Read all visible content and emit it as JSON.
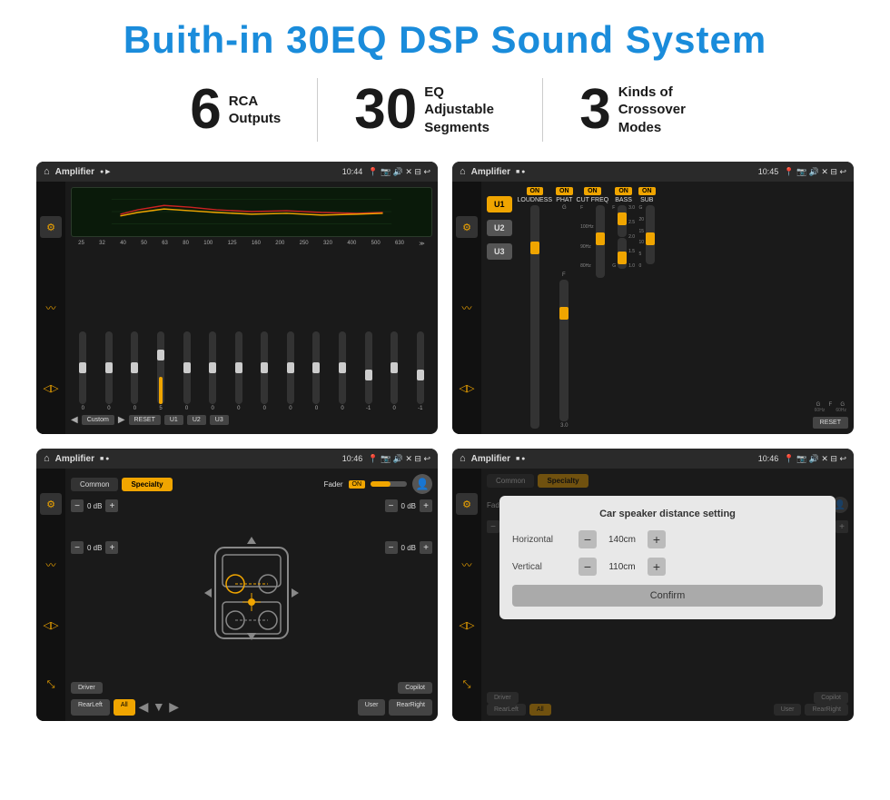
{
  "header": {
    "title": "Buith-in 30EQ DSP Sound System"
  },
  "stats": [
    {
      "number": "6",
      "label": "RCA\nOutputs"
    },
    {
      "number": "30",
      "label": "EQ Adjustable\nSegments"
    },
    {
      "number": "3",
      "label": "Kinds of\nCrossover Modes"
    }
  ],
  "screens": [
    {
      "id": "screen1",
      "statusBar": {
        "app": "Amplifier",
        "time": "10:44",
        "icons": "📍 📷 🔊 ✕ ⊓ ↩"
      }
    },
    {
      "id": "screen2",
      "statusBar": {
        "app": "Amplifier",
        "time": "10:45"
      }
    },
    {
      "id": "screen3",
      "statusBar": {
        "app": "Amplifier",
        "time": "10:46"
      }
    },
    {
      "id": "screen4",
      "statusBar": {
        "app": "Amplifier",
        "time": "10:46"
      },
      "dialog": {
        "title": "Car speaker distance setting",
        "horizontal_label": "Horizontal",
        "horizontal_value": "140cm",
        "vertical_label": "Vertical",
        "vertical_value": "110cm",
        "confirm_label": "Confirm"
      }
    }
  ],
  "eq": {
    "frequencies": [
      "25",
      "32",
      "40",
      "50",
      "63",
      "80",
      "100",
      "125",
      "160",
      "200",
      "250",
      "320",
      "400",
      "500",
      "630"
    ],
    "values": [
      "0",
      "0",
      "0",
      "5",
      "0",
      "0",
      "0",
      "0",
      "0",
      "0",
      "0",
      "-1",
      "0",
      "-1"
    ],
    "preset": "Custom",
    "buttons": [
      "RESET",
      "U1",
      "U2",
      "U3"
    ]
  },
  "amp_screen2": {
    "u_buttons": [
      "U1",
      "U2",
      "U3"
    ],
    "controls": [
      "LOUDNESS",
      "PHAT",
      "CUT FREQ",
      "BASS",
      "SUB"
    ],
    "reset": "RESET"
  },
  "crossover": {
    "tabs": [
      "Common",
      "Specialty"
    ],
    "fader_label": "Fader",
    "fader_on": "ON",
    "db_values": [
      "0 dB",
      "0 dB",
      "0 dB",
      "0 dB"
    ],
    "bottom_buttons": [
      "Driver",
      "",
      "Copilot",
      "RearLeft",
      "All",
      "",
      "User",
      "RearRight"
    ]
  },
  "distance": {
    "tabs": [
      "Common",
      "Specialty"
    ],
    "dialog_title": "Car speaker distance setting",
    "horizontal_label": "Horizontal",
    "horizontal_value": "140cm",
    "vertical_label": "Vertical",
    "vertical_value": "110cm",
    "confirm": "Confirm",
    "bottom_buttons": [
      "Driver",
      "Copilot",
      "RearLeft",
      "All",
      "User",
      "RearRight"
    ]
  }
}
